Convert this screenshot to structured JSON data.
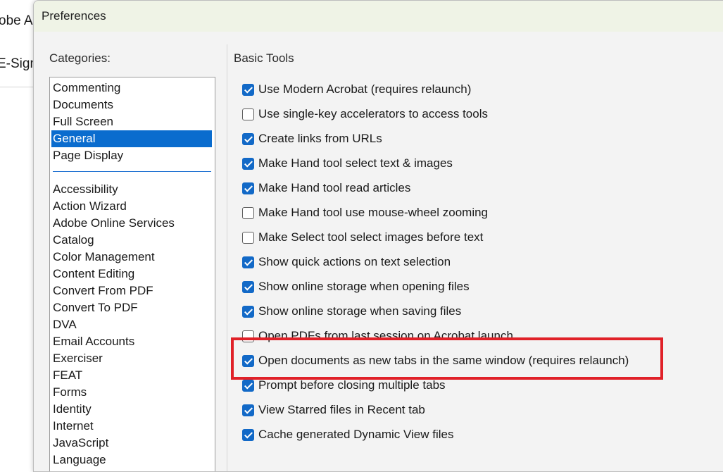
{
  "background_app": {
    "title_fragment": "obe Ac",
    "sub_fragment": "E-Sign"
  },
  "dialog": {
    "title": "Preferences",
    "categories_label": "Categories:",
    "categories_group1": [
      "Commenting",
      "Documents",
      "Full Screen",
      "General",
      "Page Display"
    ],
    "categories_group2": [
      "Accessibility",
      "Action Wizard",
      "Adobe Online Services",
      "Catalog",
      "Color Management",
      "Content Editing",
      "Convert From PDF",
      "Convert To PDF",
      "DVA",
      "Email Accounts",
      "Exerciser",
      "FEAT",
      "Forms",
      "Identity",
      "Internet",
      "JavaScript",
      "Language"
    ],
    "selected_category": "General",
    "section_title": "Basic Tools",
    "options": [
      {
        "label": "Use Modern Acrobat (requires relaunch)",
        "checked": true
      },
      {
        "label": "Use single-key accelerators to access tools",
        "checked": false
      },
      {
        "label": "Create links from URLs",
        "checked": true
      },
      {
        "label": "Make Hand tool select text & images",
        "checked": true
      },
      {
        "label": "Make Hand tool read articles",
        "checked": true
      },
      {
        "label": "Make Hand tool use mouse-wheel zooming",
        "checked": false
      },
      {
        "label": "Make Select tool select images before text",
        "checked": false
      },
      {
        "label": "Show quick actions on text selection",
        "checked": true
      },
      {
        "label": "Show online storage when opening files",
        "checked": true
      },
      {
        "label": "Show online storage when saving files",
        "checked": true
      },
      {
        "label": "Open PDFs from last session on Acrobat launch",
        "checked": false
      },
      {
        "label": "Open documents as new tabs in the same window (requires relaunch)",
        "checked": true
      },
      {
        "label": "Prompt before closing multiple tabs",
        "checked": true
      },
      {
        "label": "View Starred files in Recent tab",
        "checked": true
      },
      {
        "label": "Cache generated Dynamic View files",
        "checked": true
      }
    ]
  },
  "colors": {
    "accent": "#0a6cce",
    "highlight": "#e02128"
  }
}
